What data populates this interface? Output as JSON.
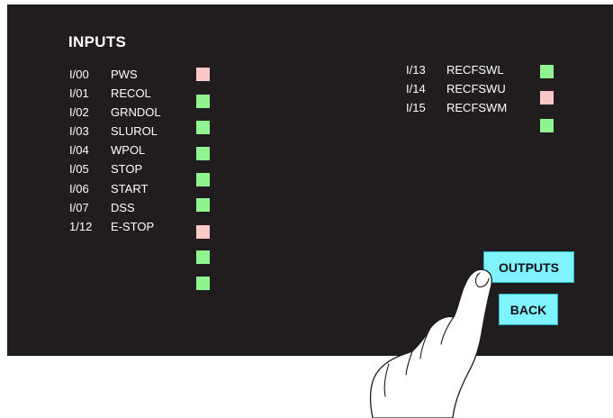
{
  "screen": {
    "title": "INPUTS"
  },
  "inputs_left": [
    {
      "address": "I/00",
      "name": "PWS"
    },
    {
      "address": "I/01",
      "name": "RECOL"
    },
    {
      "address": "I/02",
      "name": "GRNDOL"
    },
    {
      "address": "I/03",
      "name": "SLUROL"
    },
    {
      "address": "I/04",
      "name": "WPOL"
    },
    {
      "address": "I/05",
      "name": "STOP"
    },
    {
      "address": "I/06",
      "name": "START"
    },
    {
      "address": "I/07",
      "name": "DSS"
    },
    {
      "address": "1/12",
      "name": "E-STOP"
    }
  ],
  "inputs_right": [
    {
      "address": "I/13",
      "name": "RECFSWL"
    },
    {
      "address": "I/14",
      "name": "RECFSWU"
    },
    {
      "address": "I/15",
      "name": "RECFSWM"
    }
  ],
  "indicators_left": [
    "off",
    "on",
    "on",
    "on",
    "on",
    "on",
    "off",
    "on",
    "on"
  ],
  "indicators_right": [
    "on",
    "off",
    "on"
  ],
  "colors": {
    "on": "#90f590",
    "off": "#fbc8c8",
    "button": "#7ff4ff",
    "background": "#211d1e"
  },
  "buttons": {
    "outputs_label": "OUTPUTS",
    "back_label": "BACK"
  },
  "overlay_icon": "pointing-hand-icon"
}
